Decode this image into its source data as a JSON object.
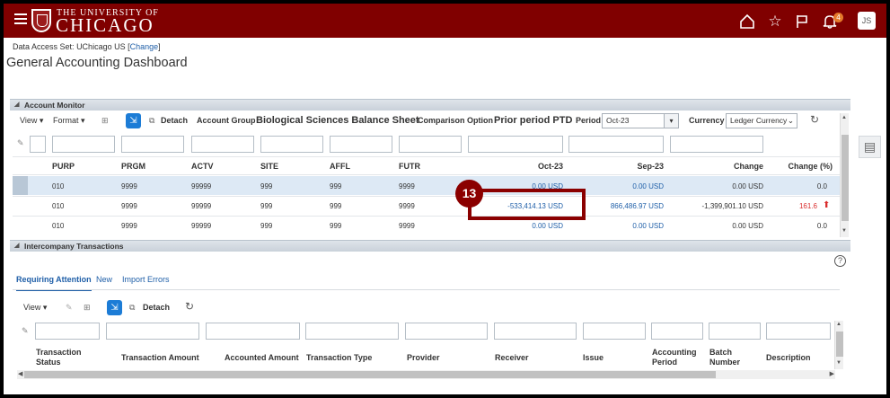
{
  "brand": {
    "line1": "THE UNIVERSITY OF",
    "line2": "CHICAGO"
  },
  "topbar": {
    "notification_count": "4",
    "user_initials": "JS"
  },
  "header": {
    "data_access_label": "Data Access Set:",
    "data_access_value": "UChicago US",
    "change_link": "Change",
    "page_title": "General Accounting Dashboard"
  },
  "account_monitor": {
    "title": "Account Monitor",
    "toolbar": {
      "view": "View",
      "format": "Format",
      "detach": "Detach",
      "account_group_label": "Account Group",
      "account_group_value": "Biological Sciences Balance Sheet",
      "comparison_label": "Comparison Option",
      "comparison_value": "Prior period PTD",
      "period_label": "Period",
      "period_value": "Oct-23",
      "currency_label": "Currency",
      "currency_value": "Ledger Currency"
    },
    "columns": [
      "PURP",
      "PRGM",
      "ACTV",
      "SITE",
      "AFFL",
      "FUTR",
      "Oct-23",
      "Sep-23",
      "Change",
      "Change (%)"
    ],
    "rows": [
      [
        "010",
        "9999",
        "99999",
        "999",
        "999",
        "9999",
        "0.00 USD",
        "0.00 USD",
        "0.00 USD",
        "0.0"
      ],
      [
        "010",
        "9999",
        "99999",
        "999",
        "999",
        "9999",
        "-533,414.13 USD",
        "866,486.97 USD",
        "-1,399,901.10 USD",
        "161.6"
      ],
      [
        "010",
        "9999",
        "99999",
        "999",
        "999",
        "9999",
        "0.00 USD",
        "0.00 USD",
        "0.00 USD",
        "0.0"
      ]
    ],
    "callout_number": "13"
  },
  "intercompany": {
    "title": "Intercompany Transactions",
    "tabs": [
      "Requiring Attention",
      "New",
      "Import Errors"
    ],
    "toolbar": {
      "view": "View",
      "detach": "Detach"
    },
    "columns": [
      "Transaction Status",
      "Transaction Amount",
      "Accounted Amount",
      "Transaction Type",
      "Provider",
      "Receiver",
      "Issue",
      "Accounting Period",
      "Batch Number",
      "Description"
    ]
  },
  "colors": {
    "brand": "#800000",
    "link": "#1f5fa8",
    "negative": "#d92c2c",
    "callout": "#8b0000"
  }
}
